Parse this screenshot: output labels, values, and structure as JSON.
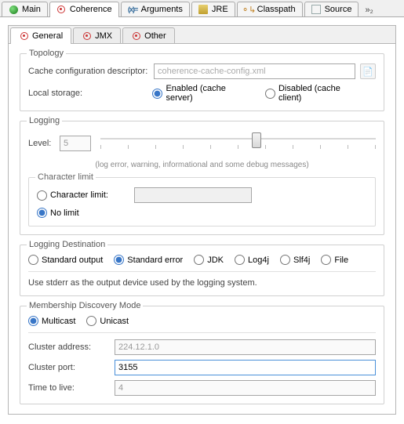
{
  "outerTabs": {
    "main": "Main",
    "coherence": "Coherence",
    "arguments": "Arguments",
    "jre": "JRE",
    "classpath": "Classpath",
    "source": "Source",
    "more": "»₂"
  },
  "innerTabs": {
    "general": "General",
    "jmx": "JMX",
    "other": "Other"
  },
  "topology": {
    "legend": "Topology",
    "descriptorLabel": "Cache configuration descriptor:",
    "descriptorPlaceholder": "coherence-cache-config.xml",
    "localStorageLabel": "Local storage:",
    "enabledLabel": "Enabled (cache server)",
    "disabledLabel": "Disabled (cache client)"
  },
  "logging": {
    "legend": "Logging",
    "levelLabel": "Level:",
    "levelValue": "5",
    "levelDesc": "(log error, warning, informational and some debug messages)",
    "charLimitLegend": "Character limit",
    "charLimitLabel": "Character limit:",
    "noLimitLabel": "No limit"
  },
  "dest": {
    "legend": "Logging Destination",
    "stdout": "Standard output",
    "stderr": "Standard error",
    "jdk": "JDK",
    "log4j": "Log4j",
    "slf4j": "Slf4j",
    "file": "File",
    "desc": "Use stderr as the output device used by the logging system."
  },
  "membership": {
    "legend": "Membership Discovery Mode",
    "multicast": "Multicast",
    "unicast": "Unicast",
    "clusterAddrLabel": "Cluster address:",
    "clusterAddrValue": "224.12.1.0",
    "clusterPortLabel": "Cluster port:",
    "clusterPortValue": "3155",
    "ttlLabel": "Time to live:",
    "ttlValue": "4"
  }
}
